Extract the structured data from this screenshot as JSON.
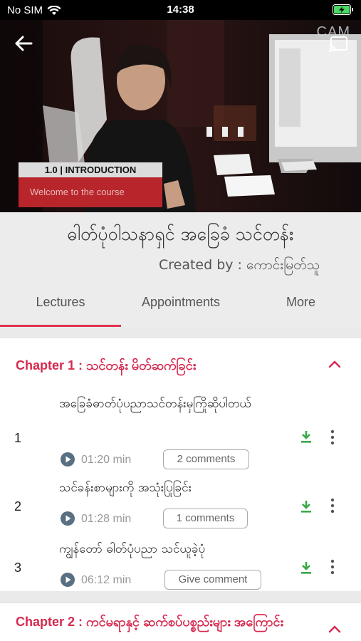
{
  "status_bar": {
    "carrier": "No SIM",
    "time": "14:38"
  },
  "video": {
    "watermark": "CAM",
    "lower_third_tag": "1.0 | INTRODUCTION",
    "lower_third_sub": "Welcome to the course"
  },
  "course": {
    "title": "ဓါတ်ပုံဝါသနာရှင် အခြေခံ သင်တန်း",
    "created_by": "Created by : ကောင်းမြတ်သူ"
  },
  "tabs": [
    {
      "label": "Lectures",
      "active": true
    },
    {
      "label": "Appointments",
      "active": false
    },
    {
      "label": "More",
      "active": false
    }
  ],
  "colors": {
    "accent": "#e0334f",
    "download": "#3aa94a",
    "play": "#5a7082"
  },
  "chapters": [
    {
      "title": "Chapter 1 : သင်တန်း မိတ်ဆက်ခြင်း",
      "lectures": [
        {
          "num": "1",
          "title": "အခြေခံဓာတ်ပုံပညာသင်တန်းမှကြိုဆိုပါတယ်",
          "duration": "01:20 min",
          "comment": "2 comments"
        },
        {
          "num": "2",
          "title": "သင်ခန်းစာများကို အသုံးပြုခြင်း",
          "duration": "01:28 min",
          "comment": "1 comments"
        },
        {
          "num": "3",
          "title": "ကျွန်တော် ဓါတ်ပုံပညာ သင်ယူခဲ့ပုံ",
          "duration": "06:12 min",
          "comment": "Give comment"
        }
      ]
    },
    {
      "title": "Chapter 2 : ကင်မရာနှင့် ဆက်စပ်ပစ္စည်းများ အကြောင်း"
    }
  ]
}
